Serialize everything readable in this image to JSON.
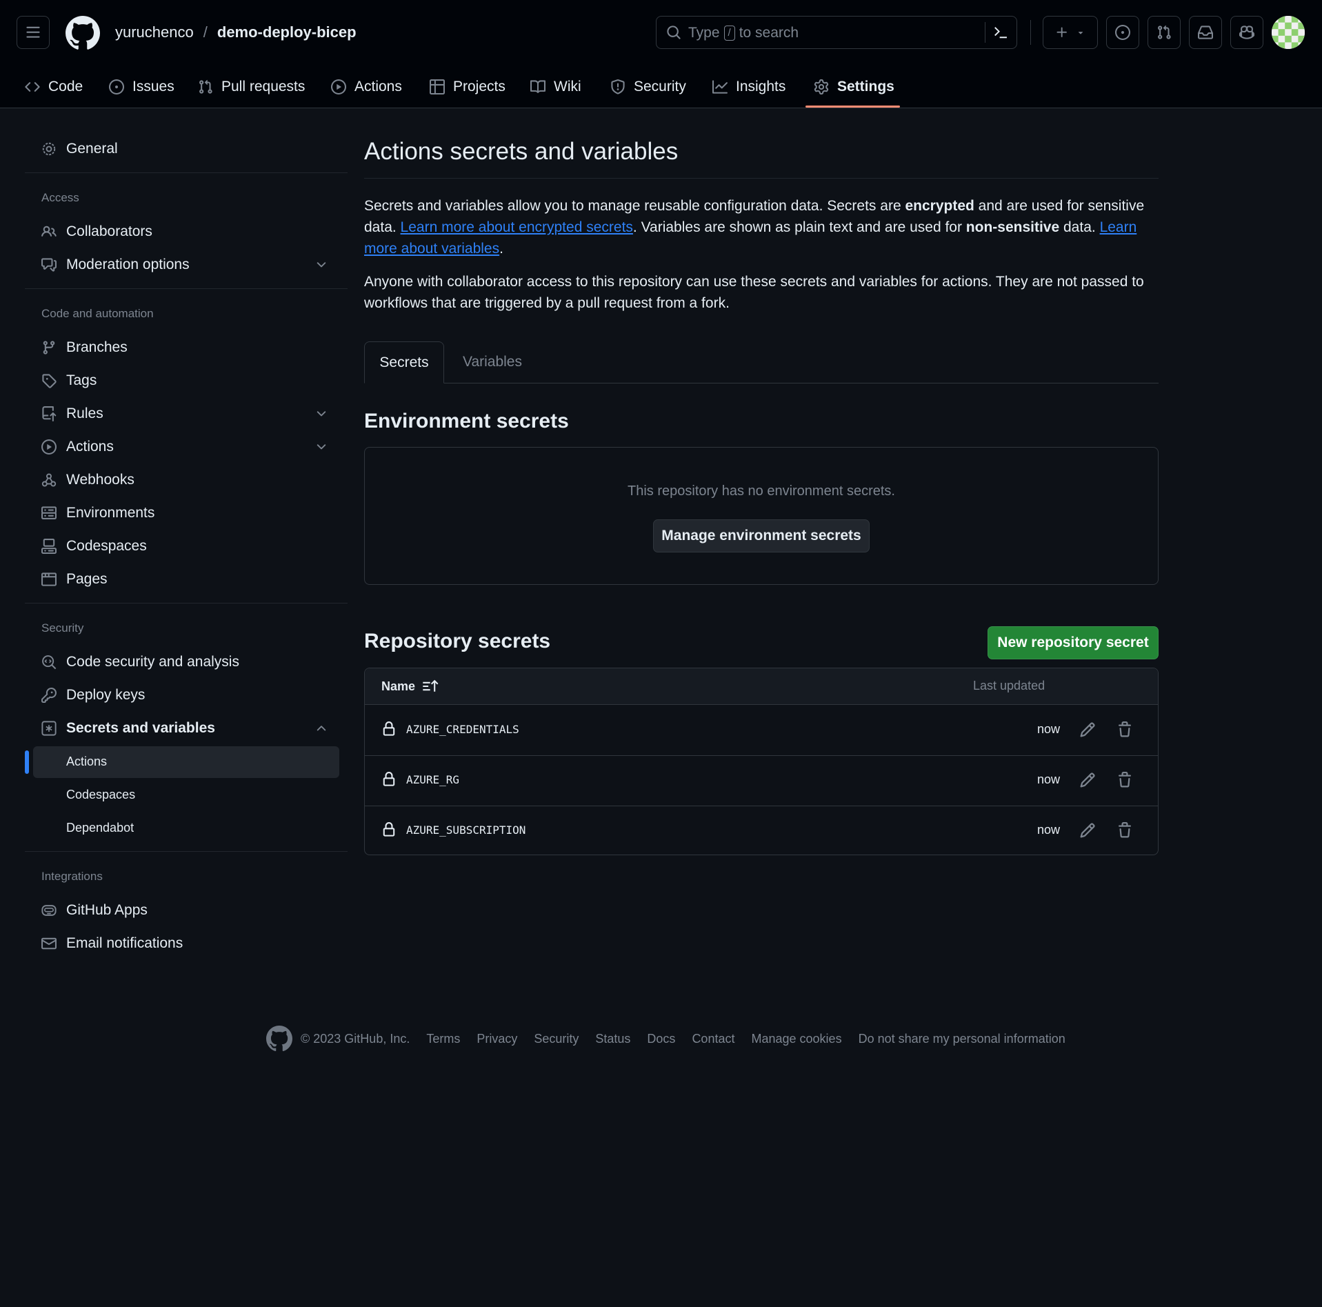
{
  "header": {
    "owner": "yuruchenco",
    "separator": "/",
    "repo": "demo-deploy-bicep",
    "search": {
      "before": "Type",
      "key": "/",
      "after": "to search"
    }
  },
  "repo_tabs": [
    {
      "label": "Code",
      "icon": "code-icon"
    },
    {
      "label": "Issues",
      "icon": "issue-icon"
    },
    {
      "label": "Pull requests",
      "icon": "pull-request-icon"
    },
    {
      "label": "Actions",
      "icon": "play-icon"
    },
    {
      "label": "Projects",
      "icon": "table-icon"
    },
    {
      "label": "Wiki",
      "icon": "book-icon"
    },
    {
      "label": "Security",
      "icon": "shield-icon"
    },
    {
      "label": "Insights",
      "icon": "graph-icon"
    },
    {
      "label": "Settings",
      "icon": "gear-icon",
      "active": true
    }
  ],
  "sidebar": {
    "general": "General",
    "access_heading": "Access",
    "collaborators": "Collaborators",
    "moderation": "Moderation options",
    "code_heading": "Code and automation",
    "branches": "Branches",
    "tags": "Tags",
    "rules": "Rules",
    "actions": "Actions",
    "webhooks": "Webhooks",
    "environments": "Environments",
    "codespaces": "Codespaces",
    "pages": "Pages",
    "security_heading": "Security",
    "code_security": "Code security and analysis",
    "deploy_keys": "Deploy keys",
    "secrets": "Secrets and variables",
    "secrets_sub": [
      "Actions",
      "Codespaces",
      "Dependabot"
    ],
    "integrations_heading": "Integrations",
    "github_apps": "GitHub Apps",
    "email_notifications": "Email notifications"
  },
  "main": {
    "title": "Actions secrets and variables",
    "intro": {
      "t1": "Secrets and variables allow you to manage reusable configuration data. Secrets are ",
      "b1": "encrypted",
      "t2": " and are used for sensitive data. ",
      "link1": "Learn more about encrypted secrets",
      "t3": ". Variables are shown as plain text and are used for ",
      "b2": "non-sensitive",
      "t4": " data. ",
      "link2": "Learn more about variables",
      "t5": "."
    },
    "notice": "Anyone with collaborator access to this repository can use these secrets and variables for actions. They are not passed to workflows that are triggered by a pull request from a fork.",
    "tabs": [
      "Secrets",
      "Variables"
    ],
    "env_heading": "Environment secrets",
    "env_empty": "This repository has no environment secrets.",
    "env_button": "Manage environment secrets",
    "repo_heading": "Repository secrets",
    "new_button": "New repository secret",
    "table": {
      "col_name": "Name",
      "col_updated": "Last updated",
      "rows": [
        {
          "name": "AZURE_CREDENTIALS",
          "updated": "now"
        },
        {
          "name": "AZURE_RG",
          "updated": "now"
        },
        {
          "name": "AZURE_SUBSCRIPTION",
          "updated": "now"
        }
      ]
    }
  },
  "footer": {
    "copyright": "© 2023 GitHub, Inc.",
    "links": [
      "Terms",
      "Privacy",
      "Security",
      "Status",
      "Docs",
      "Contact",
      "Manage cookies",
      "Do not share my personal information"
    ]
  },
  "colors": {
    "background": "#0d1117",
    "header": "#010409",
    "accent_link": "#2f81f7",
    "primary_button": "#238636",
    "active_tab_underline": "#fd8c73"
  }
}
